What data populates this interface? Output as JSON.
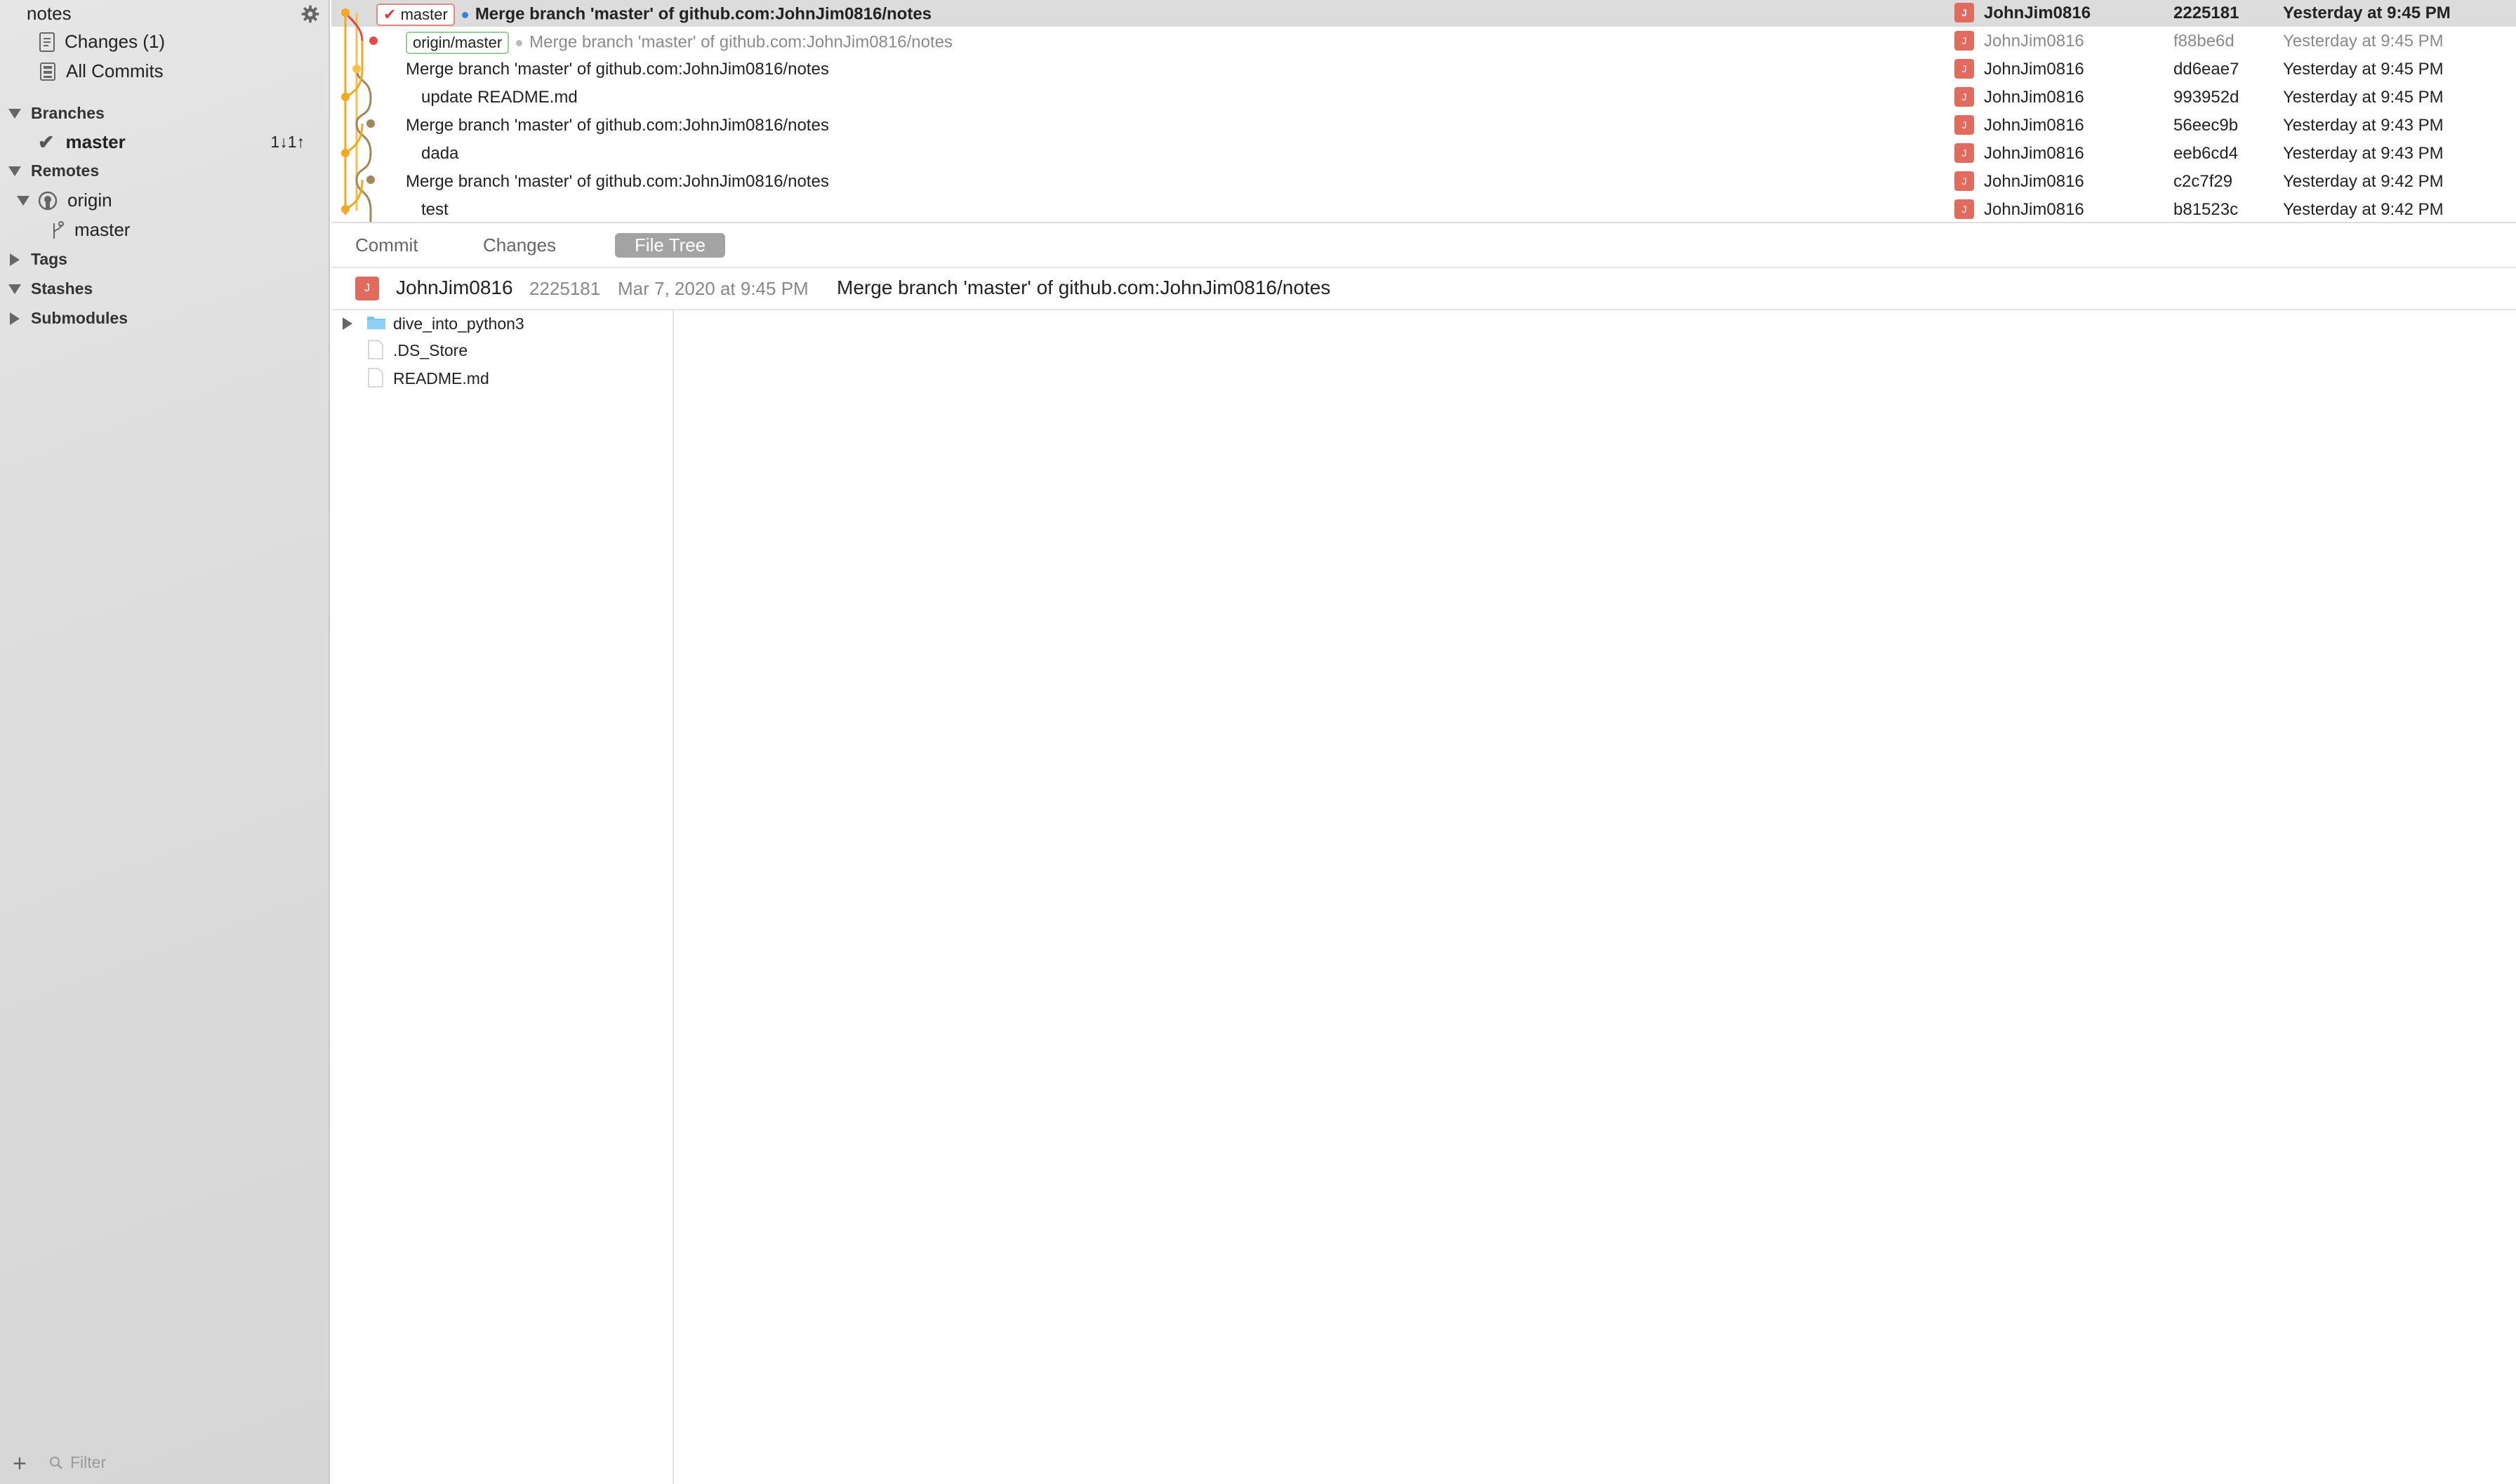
{
  "sidebar": {
    "title": "notes",
    "changes_label": "Changes (1)",
    "all_commits_label": "All Commits",
    "branches_header": "Branches",
    "current_branch": "master",
    "branch_status": "1↓1↑",
    "remotes_header": "Remotes",
    "remote_name": "origin",
    "remote_branch": "master",
    "tags_header": "Tags",
    "stashes_header": "Stashes",
    "submodules_header": "Submodules",
    "filter_placeholder": "Filter"
  },
  "commits": [
    {
      "tag": "master",
      "message": "Merge branch 'master' of github.com:JohnJim0816/notes",
      "author": "JohnJim0816",
      "hash": "2225181",
      "date": "Yesterday at 9:45 PM"
    },
    {
      "tag": "origin/master",
      "message": "Merge branch 'master' of github.com:JohnJim0816/notes",
      "author": "JohnJim0816",
      "hash": "f88be6d",
      "date": "Yesterday at 9:45 PM"
    },
    {
      "message": "Merge branch 'master' of github.com:JohnJim0816/notes",
      "author": "JohnJim0816",
      "hash": "dd6eae7",
      "date": "Yesterday at 9:45 PM"
    },
    {
      "message": "update README.md",
      "author": "JohnJim0816",
      "hash": "993952d",
      "date": "Yesterday at 9:45 PM"
    },
    {
      "message": "Merge branch 'master' of github.com:JohnJim0816/notes",
      "author": "JohnJim0816",
      "hash": "56eec9b",
      "date": "Yesterday at 9:43 PM"
    },
    {
      "message": "dada",
      "author": "JohnJim0816",
      "hash": "eeb6cd4",
      "date": "Yesterday at 9:43 PM"
    },
    {
      "message": "Merge branch 'master' of github.com:JohnJim0816/notes",
      "author": "JohnJim0816",
      "hash": "c2c7f29",
      "date": "Yesterday at 9:42 PM"
    },
    {
      "message": "test",
      "author": "JohnJim0816",
      "hash": "b81523c",
      "date": "Yesterday at 9:42 PM"
    }
  ],
  "tabs": {
    "commit": "Commit",
    "changes": "Changes",
    "file_tree": "File Tree"
  },
  "commit_detail": {
    "author_initial": "J",
    "author": "JohnJim0816",
    "hash": "2225181",
    "date": "Mar 7, 2020 at 9:45 PM",
    "message": "Merge branch 'master' of github.com:JohnJim0816/notes"
  },
  "file_tree": [
    {
      "name": "dive_into_python3",
      "type": "folder"
    },
    {
      "name": ".DS_Store",
      "type": "file"
    },
    {
      "name": "README.md",
      "type": "file"
    }
  ],
  "colors": {
    "avatar": "#e06b5e",
    "graph_orange": "#f5a623",
    "graph_brown": "#a0875a",
    "selected_row": "#dcdcdc"
  }
}
